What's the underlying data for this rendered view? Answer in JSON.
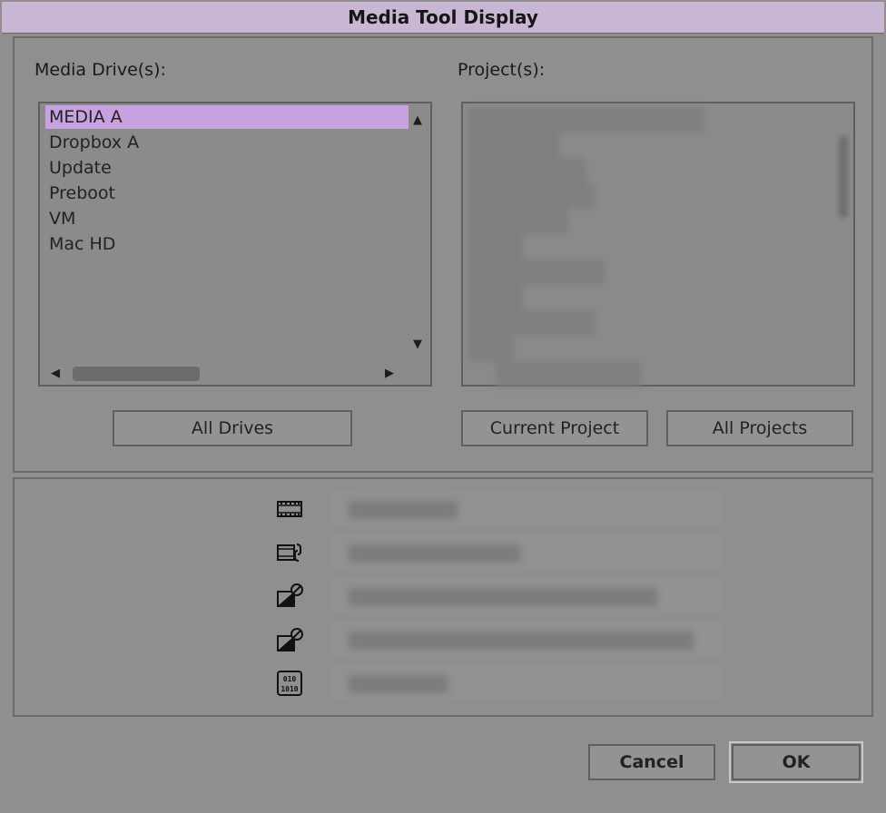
{
  "window": {
    "title": "Media Tool Display"
  },
  "drives": {
    "label": "Media Drive(s):",
    "items": [
      "MEDIA A",
      "Dropbox A",
      "Update",
      "Preboot",
      "VM",
      "Mac HD"
    ],
    "selected": "MEDIA A",
    "all_button": "All Drives"
  },
  "projects": {
    "label": "Project(s):",
    "blurred_items": [
      "",
      "",
      "",
      "",
      "",
      "",
      "",
      "",
      "",
      "",
      ""
    ],
    "current_button": "Current Project",
    "all_button": "All Projects"
  },
  "options": {
    "items": [
      {
        "icon": "film-icon",
        "label": ""
      },
      {
        "icon": "linked-film-icon",
        "label": ""
      },
      {
        "icon": "precompute-clip-icon",
        "label": ""
      },
      {
        "icon": "precompute-clip-icon",
        "label": ""
      },
      {
        "icon": "binary-file-icon",
        "label": ""
      }
    ]
  },
  "footer": {
    "cancel_label": "Cancel",
    "ok_label": "OK"
  },
  "colors": {
    "title_bar": "#c9b6d2",
    "selection": "#c8a2e0",
    "background": "#8f8f8f"
  }
}
